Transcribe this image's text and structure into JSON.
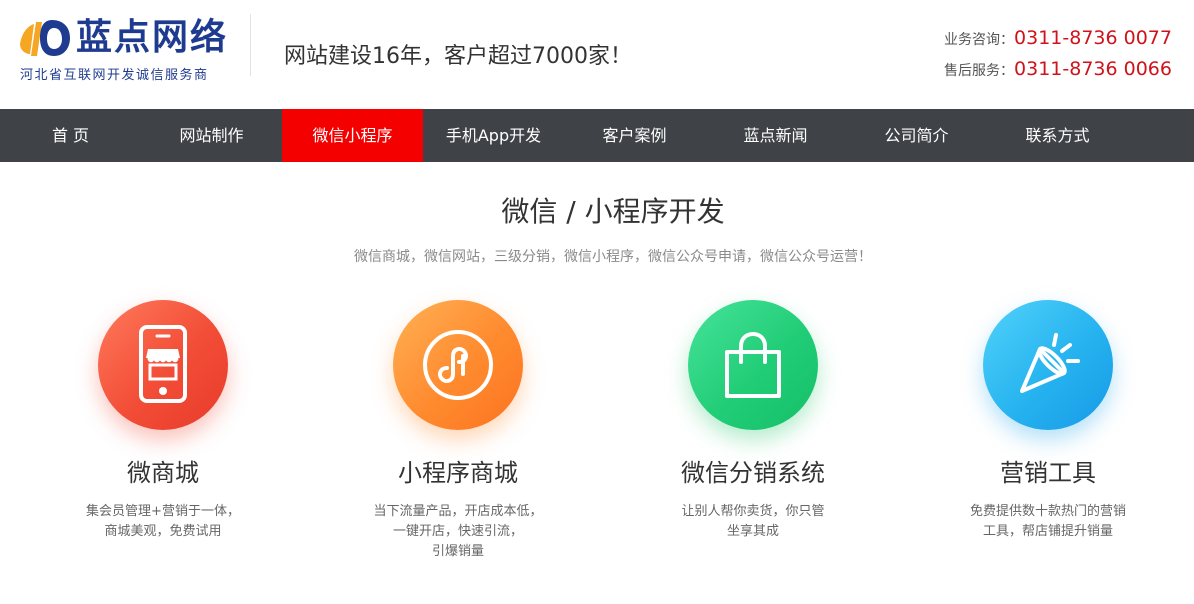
{
  "brand": {
    "name": "蓝点网络",
    "tagline": "河北省互联网开发诚信服务商",
    "logo_color": "#1f3b8f"
  },
  "slogan": "网站建设16年，客户超过7000家！",
  "contact": {
    "sales_label": "业务咨询",
    "sales_phone": "0311-8736 0077",
    "support_label": "售后服务",
    "support_phone": "0311-8736 0066",
    "separator": "：",
    "phone_color": "#d0121b"
  },
  "nav": {
    "items": [
      {
        "label": "首 页"
      },
      {
        "label": "网站制作"
      },
      {
        "label": "微信小程序",
        "active": true
      },
      {
        "label": "手机App开发"
      },
      {
        "label": "客户案例"
      },
      {
        "label": "蓝点新闻"
      },
      {
        "label": "公司简介"
      },
      {
        "label": "联系方式"
      }
    ],
    "active_color": "#f40000",
    "bg_color": "#3f4246"
  },
  "section": {
    "title": "微信 / 小程序开发",
    "subtitle": "微信商城，微信网站，三级分销，微信小程序，微信公众号申请，微信公众号运营！"
  },
  "features": [
    {
      "icon": "phone-store-icon",
      "color": "#f24d36",
      "title": "微商城",
      "desc_line1": "集会员管理+营销于一体，",
      "desc_line2": "商城美观，免费试用",
      "desc_line3": ""
    },
    {
      "icon": "mini-program-icon",
      "color": "#ff8a2e",
      "title": "小程序商城",
      "desc_line1": "当下流量产品，开店成本低，",
      "desc_line2": "一键开店，快速引流，",
      "desc_line3": "引爆销量"
    },
    {
      "icon": "shopping-bag-icon",
      "color": "#22cd77",
      "title": "微信分销系统",
      "desc_line1": "让别人帮你卖货，你只管",
      "desc_line2": "坐享其成",
      "desc_line3": ""
    },
    {
      "icon": "megaphone-icon",
      "color": "#26b3ef",
      "title": "营销工具",
      "desc_line1": "免费提供数十款热门的营销",
      "desc_line2": "工具，帮店铺提升销量",
      "desc_line3": ""
    }
  ]
}
